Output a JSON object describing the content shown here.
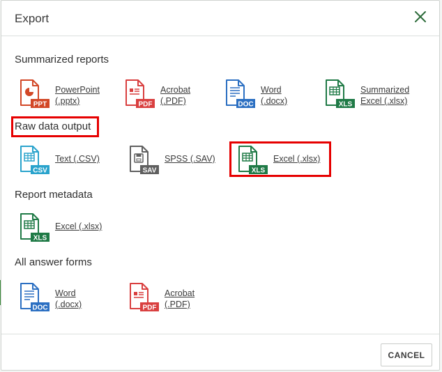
{
  "dialog": {
    "title": "Export",
    "cancel_label": "CANCEL"
  },
  "sections": {
    "summarized": {
      "title": "Summarized reports"
    },
    "raw": {
      "title": "Raw data output"
    },
    "metadata": {
      "title": "Report metadata"
    },
    "answers": {
      "title": "All answer forms"
    }
  },
  "items": {
    "sum_ppt": {
      "line1": "PowerPoint",
      "line2": "(.pptx)",
      "badge": "PPT",
      "icon": "powerpoint-icon",
      "color": "#d24726"
    },
    "sum_pdf": {
      "line1": "Acrobat",
      "line2": "(.PDF)",
      "badge": "PDF",
      "icon": "pdf-icon",
      "color": "#d93f3f"
    },
    "sum_doc": {
      "line1": "Word",
      "line2": "(.docx)",
      "badge": "DOC",
      "icon": "word-icon",
      "color": "#2b6fc2"
    },
    "sum_xls": {
      "line1": "Summarized",
      "line2": "Excel (.xlsx)",
      "badge": "XLS",
      "icon": "excel-icon",
      "color": "#1f7a46"
    },
    "raw_csv": {
      "line1": "Text (.CSV)",
      "badge": "CSV",
      "icon": "csv-icon",
      "color": "#29a3cc"
    },
    "raw_sav": {
      "line1": "SPSS (.SAV)",
      "badge": "SAV",
      "icon": "spss-icon",
      "color": "#5f5f5f"
    },
    "raw_xls": {
      "line1": "Excel (.xlsx)",
      "badge": "XLS",
      "icon": "excel-icon",
      "color": "#1f7a46"
    },
    "meta_xls": {
      "line1": "Excel (.xlsx)",
      "badge": "XLS",
      "icon": "excel-icon",
      "color": "#1f7a46"
    },
    "ans_doc": {
      "line1": "Word",
      "line2": "(.docx)",
      "badge": "DOC",
      "icon": "word-icon",
      "color": "#2b6fc2"
    },
    "ans_pdf": {
      "line1": "Acrobat",
      "line2": "(.PDF)",
      "badge": "PDF",
      "icon": "pdf-icon",
      "color": "#d93f3f"
    }
  },
  "colors": {
    "highlight": "#e60000",
    "close_icon": "#2d6b3a"
  }
}
